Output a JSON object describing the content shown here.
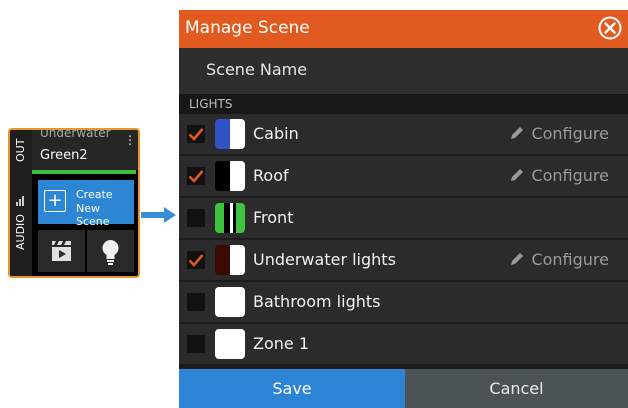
{
  "mini_panel": {
    "side_top_label": "OUT",
    "side_bottom_label": "AUDIO",
    "scene_title": "Underwater",
    "scene_subtitle": "Green2",
    "create_line1": "Create",
    "create_line2": "New Scene",
    "icons": [
      "scene-clapper-icon",
      "lightbulb-icon"
    ]
  },
  "dialog": {
    "title": "Manage Scene",
    "scene_name_placeholder": "Scene Name",
    "section_label": "LIGHTS",
    "configure_label": "Configure",
    "lights": [
      {
        "name": "Cabin",
        "checked": true,
        "configure": true,
        "swatch": [
          "#ffffff",
          "#2f52c5"
        ]
      },
      {
        "name": "Roof",
        "checked": true,
        "configure": true,
        "swatch": [
          "#ffffff",
          "#000000"
        ]
      },
      {
        "name": "Front",
        "checked": false,
        "configure": false,
        "swatch": [
          "#ffffff",
          "#000000",
          "#3fc341"
        ]
      },
      {
        "name": "Underwater lights",
        "checked": true,
        "configure": true,
        "swatch": [
          "#ffffff",
          "#3a0a00"
        ]
      },
      {
        "name": "Bathroom lights",
        "checked": false,
        "configure": false,
        "swatch": [
          "#ffffff"
        ]
      },
      {
        "name": "Zone 1",
        "checked": false,
        "configure": false,
        "swatch": [
          "#ffffff"
        ]
      }
    ],
    "save_label": "Save",
    "cancel_label": "Cancel"
  },
  "colors": {
    "header": "#e15a1f",
    "accent_blue": "#2d83d4",
    "check": "#e15a1f",
    "panel_border": "#e8952b"
  }
}
